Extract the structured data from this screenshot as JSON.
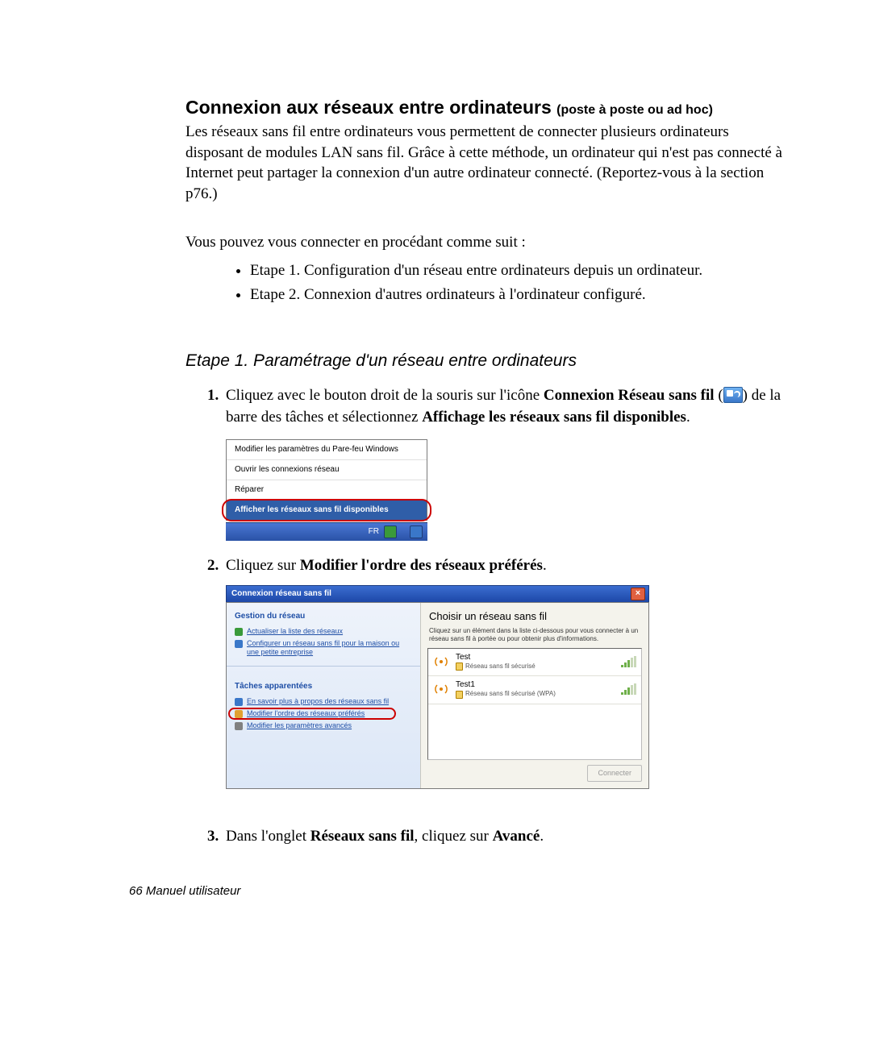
{
  "section": {
    "title_main": "Connexion aux réseaux entre ordinateurs",
    "title_sub": "(poste à poste ou ad hoc)",
    "paragraph_intro": "Les réseaux sans fil entre ordinateurs vous permettent de connecter plusieurs ordinateurs disposant de modules LAN sans fil. Grâce à cette méthode, un ordinateur qui n'est pas connecté à Internet peut partager la connexion d'un autre ordinateur connecté. (Reportez-vous à la section p76.)",
    "paragraph_follow": "Vous pouvez vous connecter en procédant comme suit :",
    "bullets": [
      "Etape 1. Configuration d'un réseau entre ordinateurs depuis un ordinateur.",
      "Etape 2. Connexion d'autres ordinateurs à l'ordinateur configuré."
    ],
    "step_heading": "Etape 1. Paramétrage d'un réseau entre ordinateurs"
  },
  "steps": {
    "s1_a": "Cliquez avec le bouton droit de la souris sur l'icône ",
    "s1_b_bold": "Connexion Réseau sans fil",
    "s1_c": " (",
    "s1_d": ") de la barre des tâches et sélectionnez ",
    "s1_e_bold": "Affichage les réseaux sans fil disponibles",
    "s1_f": ".",
    "s2_a": "Cliquez sur ",
    "s2_b_bold": "Modifier l'ordre des réseaux préférés",
    "s2_c": ".",
    "s3_a": "Dans l'onglet ",
    "s3_b_bold": "Réseaux sans fil",
    "s3_c": ", cliquez sur ",
    "s3_d_bold": "Avancé",
    "s3_e": "."
  },
  "context_menu": {
    "items": [
      "Modifier les paramètres du Pare-feu Windows",
      "Ouvrir les connexions réseau",
      "Réparer",
      "Afficher les réseaux sans fil disponibles"
    ],
    "tray_label": "FR"
  },
  "wireless_dialog": {
    "title": "Connexion réseau sans fil",
    "close_glyph": "×",
    "left": {
      "group1_title": "Gestion du réseau",
      "group1_links": [
        "Actualiser la liste des réseaux",
        "Configurer un réseau sans fil pour la maison ou une petite entreprise"
      ],
      "group2_title": "Tâches apparentées",
      "group2_links": [
        "En savoir plus à propos des réseaux sans fil",
        "Modifier l'ordre des réseaux préférés",
        "Modifier les paramètres avancés"
      ]
    },
    "right": {
      "title": "Choisir un réseau sans fil",
      "desc": "Cliquez sur un élément dans la liste ci-dessous pour vous connecter à un réseau sans fil à portée ou pour obtenir plus d'informations.",
      "networks": [
        {
          "name": "Test",
          "security": "Réseau sans fil sécurisé"
        },
        {
          "name": "Test1",
          "security": "Réseau sans fil sécurisé (WPA)"
        }
      ],
      "connect_label": "Connecter"
    }
  },
  "footer": {
    "page_number": "66",
    "label": "Manuel utilisateur"
  }
}
